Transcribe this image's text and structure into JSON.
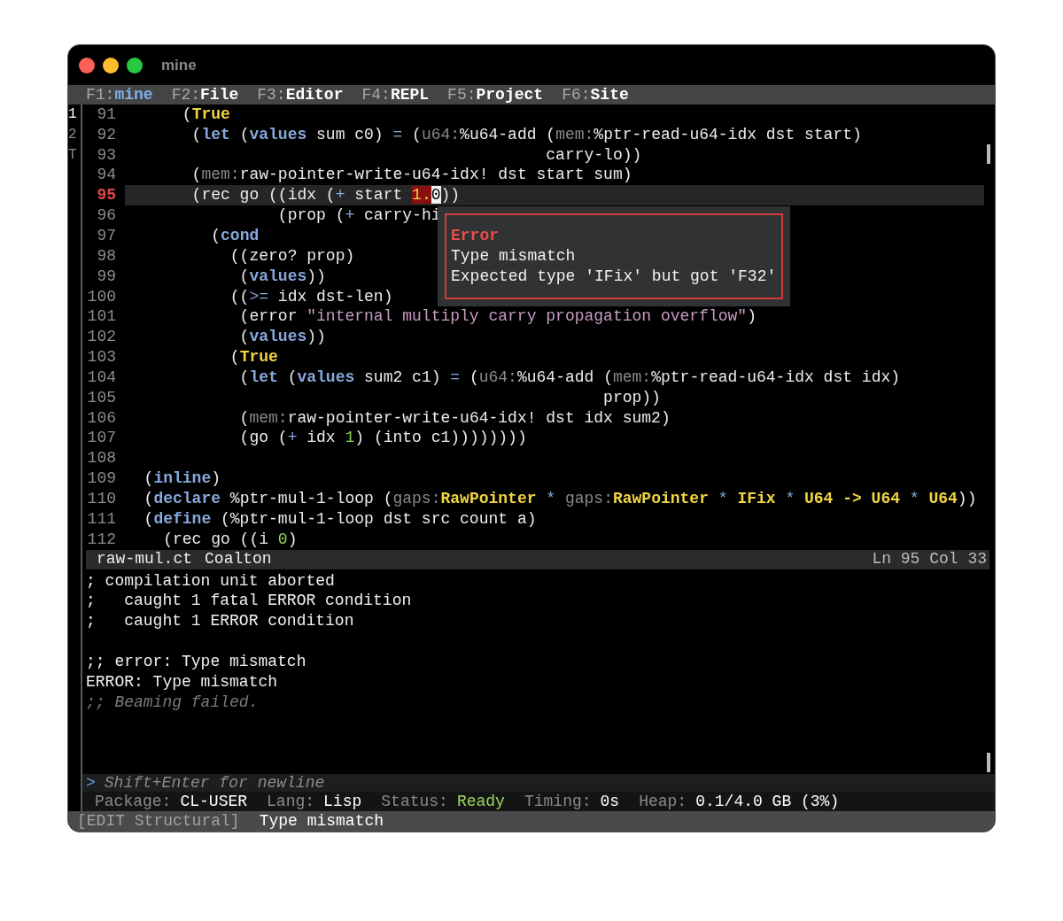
{
  "window": {
    "title": "mine"
  },
  "tabs": [
    {
      "key": "F1:",
      "label": "mine",
      "selected": true
    },
    {
      "key": "F2:",
      "label": "File",
      "selected": false
    },
    {
      "key": "F3:",
      "label": "Editor",
      "selected": false
    },
    {
      "key": "F4:",
      "label": "REPL",
      "selected": false
    },
    {
      "key": "F5:",
      "label": "Project",
      "selected": false
    },
    {
      "key": "F6:",
      "label": "Site",
      "selected": false
    }
  ],
  "window_numbers": [
    {
      "label": "1",
      "selected": true
    },
    {
      "label": "2",
      "selected": false
    },
    {
      "label": "T",
      "selected": false
    }
  ],
  "editor": {
    "lines": [
      {
        "number": "91",
        "current": false,
        "tokens": [
          {
            "kind": "plain",
            "text": "      ("
          },
          {
            "kind": "constant",
            "text": "True"
          }
        ]
      },
      {
        "number": "92",
        "current": false,
        "tokens": [
          {
            "kind": "plain",
            "text": "       ("
          },
          {
            "kind": "keyword",
            "text": "let"
          },
          {
            "kind": "plain",
            "text": " ("
          },
          {
            "kind": "keyword",
            "text": "values"
          },
          {
            "kind": "plain",
            "text": " sum c0) "
          },
          {
            "kind": "operator",
            "text": "="
          },
          {
            "kind": "plain",
            "text": " ("
          },
          {
            "kind": "package",
            "text": "u64:"
          },
          {
            "kind": "plain",
            "text": "%u64-add ("
          },
          {
            "kind": "package",
            "text": "mem:"
          },
          {
            "kind": "plain",
            "text": "%ptr-read-u64-idx dst start)"
          }
        ]
      },
      {
        "number": "93",
        "current": false,
        "tokens": [
          {
            "kind": "plain",
            "text": "                                            carry-lo))"
          }
        ]
      },
      {
        "number": "94",
        "current": false,
        "tokens": [
          {
            "kind": "plain",
            "text": "       ("
          },
          {
            "kind": "package",
            "text": "mem:"
          },
          {
            "kind": "plain",
            "text": "raw-pointer-write-u64-idx! dst start sum)"
          }
        ]
      },
      {
        "number": "95",
        "current": true,
        "tokens": [
          {
            "kind": "plain",
            "text": "       (rec go ((idx ("
          },
          {
            "kind": "operator",
            "text": "+"
          },
          {
            "kind": "plain",
            "text": " start "
          },
          {
            "kind": "error",
            "text": "1."
          },
          {
            "kind": "cursor",
            "text": "0"
          },
          {
            "kind": "plain",
            "text": "))"
          }
        ]
      },
      {
        "number": "96",
        "current": false,
        "tokens": [
          {
            "kind": "plain",
            "text": "                (prop ("
          },
          {
            "kind": "operator",
            "text": "+"
          },
          {
            "kind": "plain",
            "text": " carry-hi"
          }
        ]
      },
      {
        "number": "97",
        "current": false,
        "tokens": [
          {
            "kind": "plain",
            "text": "         ("
          },
          {
            "kind": "keyword",
            "text": "cond"
          }
        ]
      },
      {
        "number": "98",
        "current": false,
        "tokens": [
          {
            "kind": "plain",
            "text": "           ((zero? prop)"
          }
        ]
      },
      {
        "number": "99",
        "current": false,
        "tokens": [
          {
            "kind": "plain",
            "text": "            ("
          },
          {
            "kind": "keyword",
            "text": "values"
          },
          {
            "kind": "plain",
            "text": "))"
          }
        ]
      },
      {
        "number": "100",
        "current": false,
        "tokens": [
          {
            "kind": "plain",
            "text": "           (("
          },
          {
            "kind": "operator",
            "text": ">="
          },
          {
            "kind": "plain",
            "text": " idx dst-len)"
          }
        ]
      },
      {
        "number": "101",
        "current": false,
        "tokens": [
          {
            "kind": "plain",
            "text": "            (error "
          },
          {
            "kind": "string",
            "text": "\"internal multiply carry propagation overflow\""
          },
          {
            "kind": "plain",
            "text": ")"
          }
        ]
      },
      {
        "number": "102",
        "current": false,
        "tokens": [
          {
            "kind": "plain",
            "text": "            ("
          },
          {
            "kind": "keyword",
            "text": "values"
          },
          {
            "kind": "plain",
            "text": "))"
          }
        ]
      },
      {
        "number": "103",
        "current": false,
        "tokens": [
          {
            "kind": "plain",
            "text": "           ("
          },
          {
            "kind": "constant",
            "text": "True"
          }
        ]
      },
      {
        "number": "104",
        "current": false,
        "tokens": [
          {
            "kind": "plain",
            "text": "            ("
          },
          {
            "kind": "keyword",
            "text": "let"
          },
          {
            "kind": "plain",
            "text": " ("
          },
          {
            "kind": "keyword",
            "text": "values"
          },
          {
            "kind": "plain",
            "text": " sum2 c1) "
          },
          {
            "kind": "operator",
            "text": "="
          },
          {
            "kind": "plain",
            "text": " ("
          },
          {
            "kind": "package",
            "text": "u64:"
          },
          {
            "kind": "plain",
            "text": "%u64-add ("
          },
          {
            "kind": "package",
            "text": "mem:"
          },
          {
            "kind": "plain",
            "text": "%ptr-read-u64-idx dst idx)"
          }
        ]
      },
      {
        "number": "105",
        "current": false,
        "tokens": [
          {
            "kind": "plain",
            "text": "                                                  prop))"
          }
        ]
      },
      {
        "number": "106",
        "current": false,
        "tokens": [
          {
            "kind": "plain",
            "text": "            ("
          },
          {
            "kind": "package",
            "text": "mem:"
          },
          {
            "kind": "plain",
            "text": "raw-pointer-write-u64-idx! dst idx sum2)"
          }
        ]
      },
      {
        "number": "107",
        "current": false,
        "tokens": [
          {
            "kind": "plain",
            "text": "            (go ("
          },
          {
            "kind": "operator",
            "text": "+"
          },
          {
            "kind": "plain",
            "text": " idx "
          },
          {
            "kind": "number",
            "text": "1"
          },
          {
            "kind": "plain",
            "text": ") (into c1))))))))"
          }
        ]
      },
      {
        "number": "108",
        "current": false
      },
      {
        "number": "109",
        "current": false,
        "tokens": [
          {
            "kind": "plain",
            "text": "  ("
          },
          {
            "kind": "keyword",
            "text": "inline"
          },
          {
            "kind": "plain",
            "text": ")"
          }
        ]
      },
      {
        "number": "110",
        "current": false,
        "tokens": [
          {
            "kind": "plain",
            "text": "  ("
          },
          {
            "kind": "keyword",
            "text": "declare"
          },
          {
            "kind": "plain",
            "text": " %ptr-mul-1-loop ("
          },
          {
            "kind": "package",
            "text": "gaps:"
          },
          {
            "kind": "constant",
            "text": "RawPointer"
          },
          {
            "kind": "operator",
            "text": " * "
          },
          {
            "kind": "package",
            "text": "gaps:"
          },
          {
            "kind": "constant",
            "text": "RawPointer"
          },
          {
            "kind": "operator",
            "text": " * "
          },
          {
            "kind": "constant",
            "text": "IFix"
          },
          {
            "kind": "operator",
            "text": " * "
          },
          {
            "kind": "constant",
            "text": "U64 -> U64"
          },
          {
            "kind": "operator",
            "text": " * "
          },
          {
            "kind": "constant",
            "text": "U64"
          },
          {
            "kind": "plain",
            "text": "))"
          }
        ]
      },
      {
        "number": "111",
        "current": false,
        "tokens": [
          {
            "kind": "plain",
            "text": "  ("
          },
          {
            "kind": "keyword",
            "text": "define"
          },
          {
            "kind": "plain",
            "text": " (%ptr-mul-1-loop dst src count a)"
          }
        ]
      },
      {
        "number": "112",
        "current": false,
        "tokens": [
          {
            "kind": "plain",
            "text": "    (rec go ((i "
          },
          {
            "kind": "number",
            "text": "0"
          },
          {
            "kind": "plain",
            "text": ")"
          }
        ]
      }
    ],
    "tooltip": {
      "title": "Error",
      "lines": [
        "Type mismatch",
        "Expected type 'IFix' but got 'F32'"
      ]
    }
  },
  "mode_line": {
    "file": "raw-mul.ct",
    "mode": "Coalton",
    "position": "Ln 95 Col 33"
  },
  "repl": {
    "lines": [
      {
        "kind": "output",
        "text": "; compilation unit aborted"
      },
      {
        "kind": "output",
        "text": ";   caught 1 fatal ERROR condition"
      },
      {
        "kind": "output",
        "text": ";   caught 1 ERROR condition"
      },
      {
        "kind": "blank"
      },
      {
        "kind": "output",
        "text": ";; error: Type mismatch"
      },
      {
        "kind": "output",
        "text": "ERROR: Type mismatch"
      },
      {
        "kind": "comment",
        "text": ";; Beaming failed."
      }
    ],
    "prompt": ">",
    "placeholder": "Shift+Enter for newline"
  },
  "info_bar": [
    {
      "label": "Package:",
      "value": "CL-USER",
      "kind": "plain"
    },
    {
      "label": "Lang:",
      "value": "Lisp",
      "kind": "plain"
    },
    {
      "label": "Status:",
      "value": "Ready",
      "kind": "good"
    },
    {
      "label": "Timing:",
      "value": "0s",
      "kind": "plain"
    },
    {
      "label": "Heap:",
      "value": "0.1/4.0 GB (3%)",
      "kind": "plain"
    }
  ],
  "echo_area": {
    "mode": "[EDIT Structural]",
    "message": "Type mismatch"
  }
}
